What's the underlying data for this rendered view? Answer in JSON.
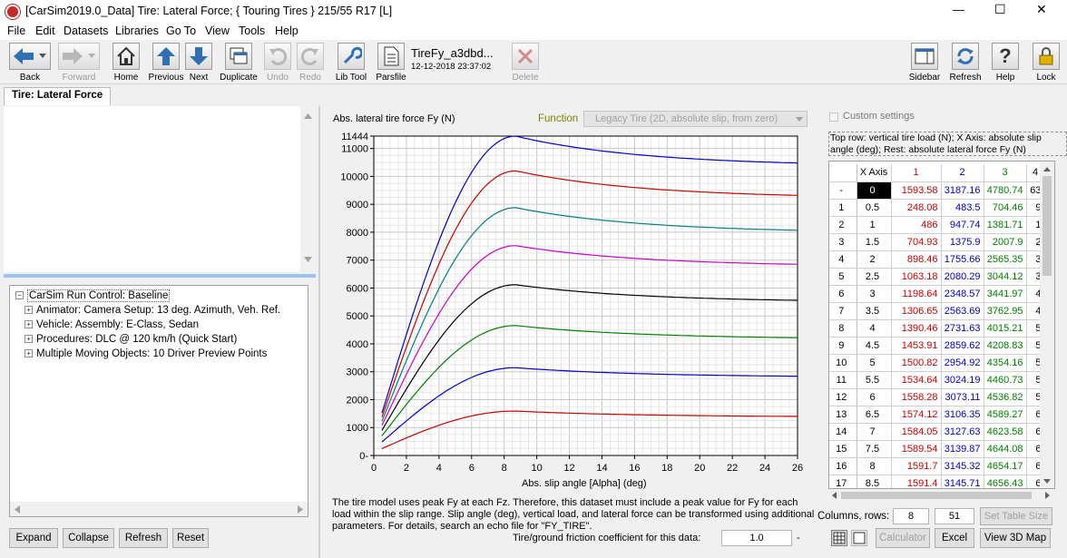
{
  "window": {
    "title": "[CarSim2019.0_Data] Tire: Lateral Force; { Touring Tires } 215/55 R17 [L]",
    "controls": [
      "—",
      "☐",
      "✕"
    ]
  },
  "menu": [
    "File",
    "Edit",
    "Datasets",
    "Libraries",
    "Go To",
    "View",
    "Tools",
    "Help"
  ],
  "toolbar": {
    "back": "Back",
    "forward": "Forward",
    "home": "Home",
    "previous": "Previous",
    "next": "Next",
    "duplicate": "Duplicate",
    "undo": "Undo",
    "redo": "Redo",
    "libtool": "Lib Tool",
    "parsfile": "Parsfile",
    "file_name": "TireFy_a3dbd...",
    "file_date": "12-12-2018 23:37:02",
    "delete": "Delete",
    "sidebar": "Sidebar",
    "refresh": "Refresh",
    "help": "Help",
    "lock": "Lock"
  },
  "tab": "Tire: Lateral Force",
  "tree": {
    "root": "CarSim Run Control: Baseline",
    "items": [
      "Animator: Camera Setup: 13 deg. Azimuth, Veh. Ref.",
      "Vehicle: Assembly: E-Class, Sedan",
      "Procedures: DLC @ 120 km/h (Quick Start)",
      "Multiple Moving Objects: 10 Driver Preview Points"
    ]
  },
  "left_buttons": {
    "expand": "Expand",
    "collapse": "Collapse",
    "refresh": "Refresh",
    "reset": "Reset"
  },
  "plot": {
    "ylabel": "Abs. lateral tire force Fy (N)",
    "function_label": "Function",
    "function_value": "Legacy Tire (2D, absolute slip, from zero)",
    "xlabel": "Abs. slip angle [Alpha] (deg)"
  },
  "description": "The tire model uses peak Fy at each Fz. Therefore, this dataset must include a peak value for Fy for each load within the slip range. Slip angle (deg), vertical load, and lateral force can be transformed using additional parameters. For details, search an echo file for \"FY_TIRE\".",
  "friction": {
    "label": "Tire/ground friction coefficient for this data:",
    "value": "1.0",
    "suffix": "-"
  },
  "custom_settings": "Custom settings",
  "table_info": "Top row: vertical tire load (N); X Axis: absolute slip angle (deg); Rest: absolute lateral force Fy (N)",
  "table": {
    "header": [
      "X Axis",
      "1",
      "2",
      "3",
      "4"
    ],
    "header_colors": [
      "#000000",
      "#cc0000",
      "#0000cc",
      "#008000",
      "#000000"
    ],
    "load_row": {
      "label": "-",
      "values": [
        "0",
        "1593.58",
        "3187.16",
        "4780.74",
        "63"
      ]
    },
    "rows": [
      {
        "idx": "1",
        "x": "0.5",
        "v": [
          "248.08",
          "483.5",
          "704.46",
          "9"
        ]
      },
      {
        "idx": "2",
        "x": "1",
        "v": [
          "486",
          "947.74",
          "1381.71",
          "1"
        ]
      },
      {
        "idx": "3",
        "x": "1.5",
        "v": [
          "704.93",
          "1375.9",
          "2007.9",
          "2"
        ]
      },
      {
        "idx": "4",
        "x": "2",
        "v": [
          "898.46",
          "1755.66",
          "2565.35",
          "3"
        ]
      },
      {
        "idx": "5",
        "x": "2.5",
        "v": [
          "1063.18",
          "2080.29",
          "3044.12",
          "3"
        ]
      },
      {
        "idx": "6",
        "x": "3",
        "v": [
          "1198.64",
          "2348.57",
          "3441.97",
          "4"
        ]
      },
      {
        "idx": "7",
        "x": "3.5",
        "v": [
          "1306.65",
          "2563.69",
          "3762.95",
          "4"
        ]
      },
      {
        "idx": "8",
        "x": "4",
        "v": [
          "1390.46",
          "2731.63",
          "4015.21",
          "5"
        ]
      },
      {
        "idx": "9",
        "x": "4.5",
        "v": [
          "1453.91",
          "2859.62",
          "4208.83",
          "5"
        ]
      },
      {
        "idx": "10",
        "x": "5",
        "v": [
          "1500.82",
          "2954.92",
          "4354.16",
          "5"
        ]
      },
      {
        "idx": "11",
        "x": "5.5",
        "v": [
          "1534.64",
          "3024.19",
          "4460.73",
          "5"
        ]
      },
      {
        "idx": "12",
        "x": "6",
        "v": [
          "1558.28",
          "3073.11",
          "4536.82",
          "5"
        ]
      },
      {
        "idx": "13",
        "x": "6.5",
        "v": [
          "1574.12",
          "3106.35",
          "4589.27",
          "6"
        ]
      },
      {
        "idx": "14",
        "x": "7",
        "v": [
          "1584.05",
          "3127.63",
          "4623.58",
          "6"
        ]
      },
      {
        "idx": "15",
        "x": "7.5",
        "v": [
          "1589.54",
          "3139.87",
          "4644.08",
          "6"
        ]
      },
      {
        "idx": "16",
        "x": "8",
        "v": [
          "1591.7",
          "3145.32",
          "4654.17",
          "6"
        ]
      },
      {
        "idx": "17",
        "x": "8.5",
        "v": [
          "1591.4",
          "3145.71",
          "4656.43",
          "6"
        ]
      }
    ]
  },
  "bottom": {
    "columns_rows_label": "Columns, rows:",
    "columns": "8",
    "rows": "51",
    "set_table_size": "Set Table Size",
    "calculator": "Calculator",
    "excel": "Excel",
    "view3d": "View 3D Map"
  },
  "chart_data": {
    "type": "line",
    "title": "",
    "xlabel": "Abs. slip angle [Alpha] (deg)",
    "ylabel": "Abs. lateral tire force Fy (N)",
    "xlim": [
      0,
      26
    ],
    "ylim": [
      0,
      11444
    ],
    "xticks": [
      0,
      2,
      4,
      6,
      8,
      10,
      12,
      14,
      16,
      18,
      20,
      22,
      24,
      26
    ],
    "yticks": [
      0,
      1000,
      2000,
      3000,
      4000,
      5000,
      6000,
      7000,
      8000,
      9000,
      10000,
      11000,
      11444
    ],
    "grid": true,
    "series": [
      {
        "color": "#cc0000",
        "peak": 1591.7,
        "end": 1400,
        "x0": 248.08
      },
      {
        "color": "#0000cc",
        "peak": 3145.7,
        "end": 2840,
        "x0": 483.5
      },
      {
        "color": "#008000",
        "peak": 4656.4,
        "end": 4220,
        "x0": 704.46
      },
      {
        "color": "#000000",
        "peak": 6120,
        "end": 5560,
        "x0": 900
      },
      {
        "color": "#cc00cc",
        "peak": 7520,
        "end": 6850,
        "x0": 1080
      },
      {
        "color": "#008080",
        "peak": 8880,
        "end": 8070,
        "x0": 1230
      },
      {
        "color": "#cc0000",
        "peak": 10200,
        "end": 9320,
        "x0": 1380
      },
      {
        "color": "#0000cc",
        "peak": 11444,
        "end": 10480,
        "x0": 1520
      }
    ]
  }
}
